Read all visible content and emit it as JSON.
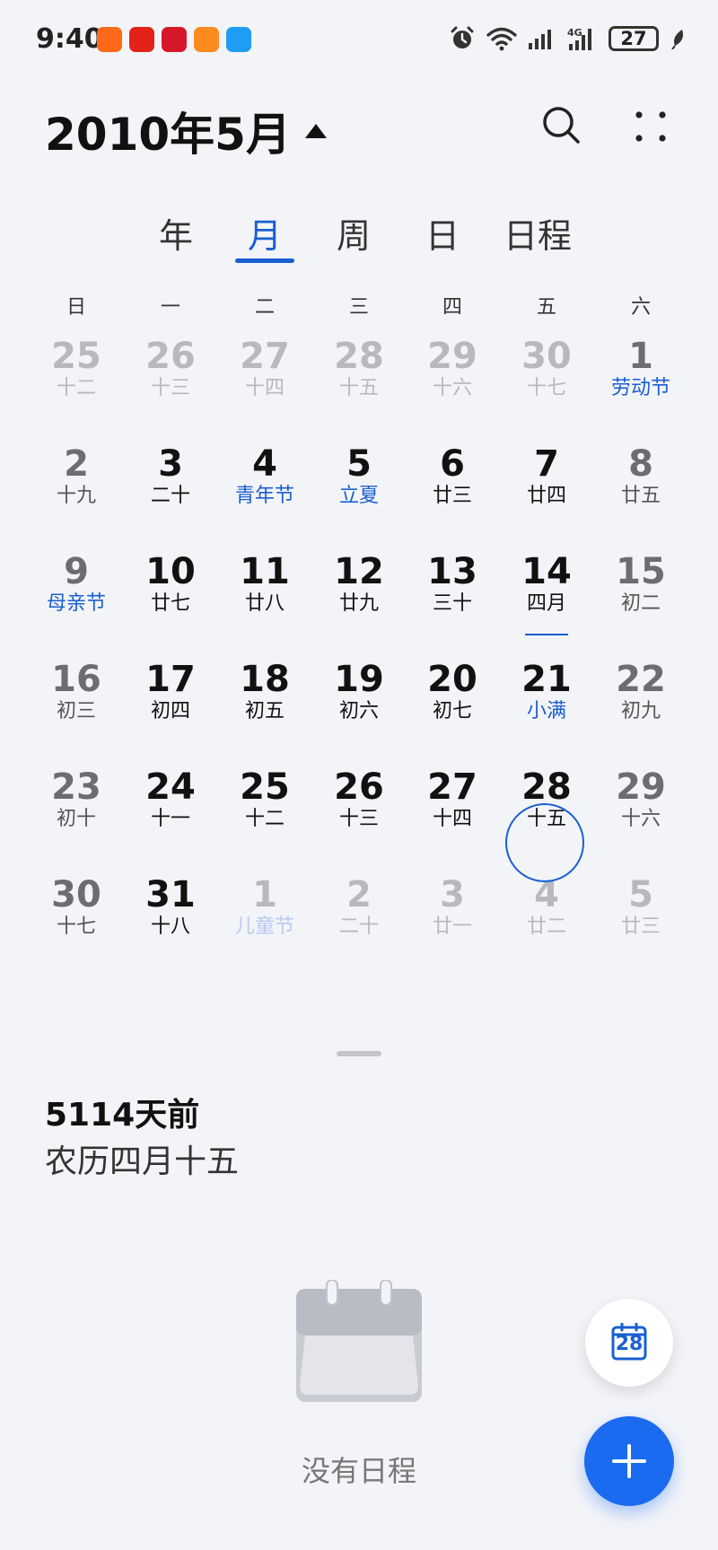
{
  "status_bar": {
    "time": "9:40",
    "battery": "27",
    "app_icons": [
      {
        "name": "taobao-app-icon",
        "color": "#ff6a1a"
      },
      {
        "name": "jd-618-app-icon",
        "color": "#e2231a"
      },
      {
        "name": "shopping-app-icon",
        "color": "#d7182a"
      },
      {
        "name": "fox-app-icon",
        "color": "#ff8a1f"
      },
      {
        "name": "message-app-icon",
        "color": "#1e9df2"
      }
    ]
  },
  "header": {
    "title": "2010年5月"
  },
  "tabs": [
    {
      "label": "年",
      "active": false
    },
    {
      "label": "月",
      "active": true
    },
    {
      "label": "周",
      "active": false
    },
    {
      "label": "日",
      "active": false
    },
    {
      "label": "日程",
      "active": false
    }
  ],
  "weekdays": [
    "日",
    "一",
    "二",
    "三",
    "四",
    "五",
    "六"
  ],
  "calendar": {
    "weeks": [
      [
        {
          "day": "25",
          "lunar": "十二",
          "dim": true
        },
        {
          "day": "26",
          "lunar": "十三",
          "dim": true
        },
        {
          "day": "27",
          "lunar": "十四",
          "dim": true
        },
        {
          "day": "28",
          "lunar": "十五",
          "dim": true
        },
        {
          "day": "29",
          "lunar": "十六",
          "dim": true
        },
        {
          "day": "30",
          "lunar": "十七",
          "dim": true
        },
        {
          "day": "1",
          "lunar": "劳动节",
          "holiday": true
        }
      ],
      [
        {
          "day": "2",
          "lunar": "十九"
        },
        {
          "day": "3",
          "lunar": "二十"
        },
        {
          "day": "4",
          "lunar": "青年节",
          "holiday": true
        },
        {
          "day": "5",
          "lunar": "立夏",
          "holiday": true
        },
        {
          "day": "6",
          "lunar": "廿三"
        },
        {
          "day": "7",
          "lunar": "廿四"
        },
        {
          "day": "8",
          "lunar": "廿五"
        }
      ],
      [
        {
          "day": "9",
          "lunar": "母亲节",
          "holiday": true
        },
        {
          "day": "10",
          "lunar": "廿七"
        },
        {
          "day": "11",
          "lunar": "廿八"
        },
        {
          "day": "12",
          "lunar": "廿九"
        },
        {
          "day": "13",
          "lunar": "三十"
        },
        {
          "day": "14",
          "lunar": "四月",
          "today": true
        },
        {
          "day": "15",
          "lunar": "初二"
        }
      ],
      [
        {
          "day": "16",
          "lunar": "初三"
        },
        {
          "day": "17",
          "lunar": "初四"
        },
        {
          "day": "18",
          "lunar": "初五"
        },
        {
          "day": "19",
          "lunar": "初六"
        },
        {
          "day": "20",
          "lunar": "初七"
        },
        {
          "day": "21",
          "lunar": "小满",
          "holiday": true
        },
        {
          "day": "22",
          "lunar": "初九"
        }
      ],
      [
        {
          "day": "23",
          "lunar": "初十"
        },
        {
          "day": "24",
          "lunar": "十一"
        },
        {
          "day": "25",
          "lunar": "十二"
        },
        {
          "day": "26",
          "lunar": "十三"
        },
        {
          "day": "27",
          "lunar": "十四"
        },
        {
          "day": "28",
          "lunar": "十五",
          "selected": true
        },
        {
          "day": "29",
          "lunar": "十六"
        }
      ],
      [
        {
          "day": "30",
          "lunar": "十七"
        },
        {
          "day": "31",
          "lunar": "十八"
        },
        {
          "day": "1",
          "lunar": "儿童节",
          "dim": true,
          "holiday": true
        },
        {
          "day": "2",
          "lunar": "二十",
          "dim": true
        },
        {
          "day": "3",
          "lunar": "廿一",
          "dim": true
        },
        {
          "day": "4",
          "lunar": "廿二",
          "dim": true
        },
        {
          "day": "5",
          "lunar": "廿三",
          "dim": true
        }
      ]
    ]
  },
  "detail": {
    "days_ago": "5114天前",
    "lunar_date": "农历四月十五"
  },
  "empty_state": {
    "text": "没有日程"
  },
  "today_button": {
    "day": "28"
  },
  "colors": {
    "accent": "#1a5fd1",
    "fab": "#1a6bef",
    "background": "#f3f4f8"
  }
}
